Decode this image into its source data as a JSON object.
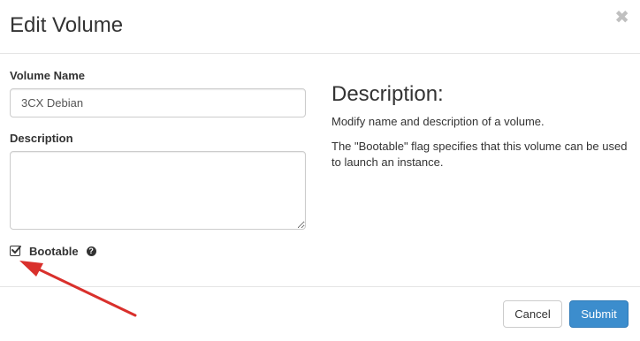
{
  "dialog": {
    "title": "Edit Volume",
    "close_symbol": "✖"
  },
  "form": {
    "volume_name_label": "Volume Name",
    "volume_name_value": "3CX Debian",
    "description_label": "Description",
    "description_value": "",
    "bootable_label": "Bootable",
    "bootable_checked": true,
    "help_symbol": "?"
  },
  "help_panel": {
    "heading": "Description:",
    "line1": "Modify name and description of a volume.",
    "line2": "The \"Bootable\" flag specifies that this volume can be used to launch an instance."
  },
  "footer": {
    "cancel_label": "Cancel",
    "submit_label": "Submit"
  },
  "colors": {
    "submit_bg": "#3c8dcd",
    "annotation_arrow": "#d9302c"
  },
  "icons": [
    "close-icon",
    "checkbox-checked-icon",
    "question-circle-icon",
    "annotation-arrow"
  ]
}
